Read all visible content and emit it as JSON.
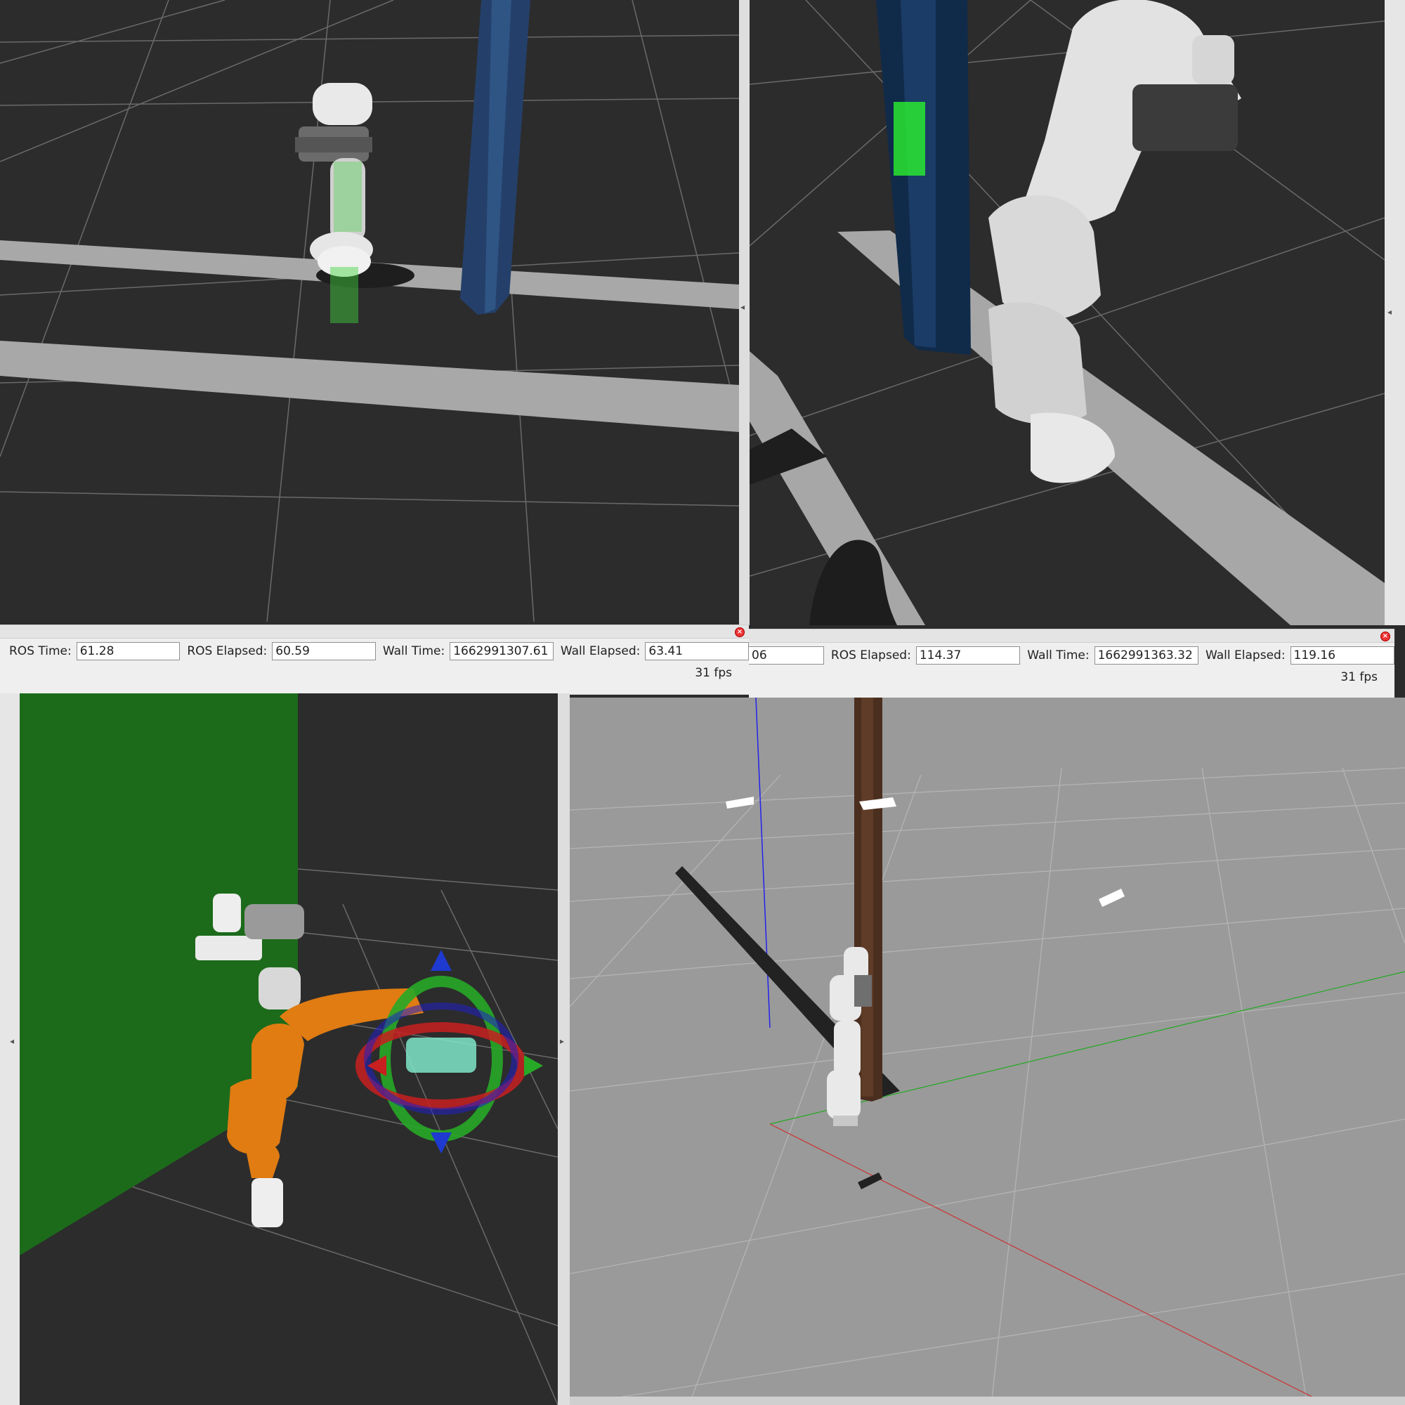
{
  "panels": {
    "top_left": {
      "type": "rviz-3d-view",
      "dark_grid": true
    },
    "top_right": {
      "type": "rviz-3d-view",
      "dark_grid": true
    },
    "bottom_left": {
      "type": "rviz-3d-view",
      "dark_grid": true,
      "wall_color": "#1c6b1b",
      "robot_color": "#e07c12"
    },
    "bottom_right": {
      "type": "gazebo-3d-view",
      "ground_color": "#9a9a9a"
    }
  },
  "status_left": {
    "ros_time_label": "ROS Time:",
    "ros_time_value": "61.28",
    "ros_elapsed_label": "ROS Elapsed:",
    "ros_elapsed_value": "60.59",
    "wall_time_label": "Wall Time:",
    "wall_time_value": "1662991307.61",
    "wall_elapsed_label": "Wall Elapsed:",
    "wall_elapsed_value": "63.41",
    "fps": "31 fps"
  },
  "status_right": {
    "ros_time_value_partial": "06",
    "ros_elapsed_label": "ROS Elapsed:",
    "ros_elapsed_value": "114.37",
    "wall_time_label": "Wall Time:",
    "wall_time_value": "1662991363.32",
    "wall_elapsed_label": "Wall Elapsed:",
    "wall_elapsed_value": "119.16",
    "fps": "31 fps"
  },
  "icons": {
    "close": "close-icon",
    "collapse": "chevron-left-icon",
    "expand": "chevron-right-icon"
  }
}
